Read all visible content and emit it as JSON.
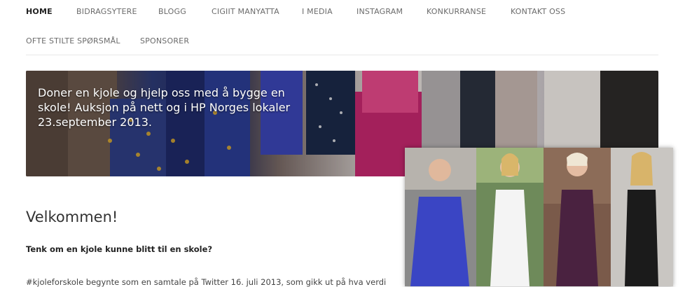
{
  "nav": {
    "items": [
      {
        "label": "HOME",
        "active": true
      },
      {
        "label": "BIDRAGSYTERE"
      },
      {
        "label": "BLOGG"
      },
      {
        "label": "CIGIIT MANYATTA"
      },
      {
        "label": "I MEDIA"
      },
      {
        "label": "INSTAGRAM"
      },
      {
        "label": "KONKURRANSE"
      },
      {
        "label": "KONTAKT OSS"
      },
      {
        "label": "OFTE STILTE SPØRSMÅL"
      },
      {
        "label": "SPONSORER"
      }
    ]
  },
  "hero": {
    "text": "Doner en kjole og hjelp oss med å bygge en skole! Auksjon på nett og i HP Norges lokaler 23.september 2013."
  },
  "content": {
    "heading": "Velkommen!",
    "lead": "Tenk om en kjole kunne blitt til en skole?",
    "paragraph": "#kjoleforskole begynte som en samtale på Twitter 16. juli 2013, som gikk ut på hva verdi"
  },
  "colors": {
    "nav_text": "#6b6b6b",
    "nav_active": "#222222",
    "heading": "#333333"
  }
}
